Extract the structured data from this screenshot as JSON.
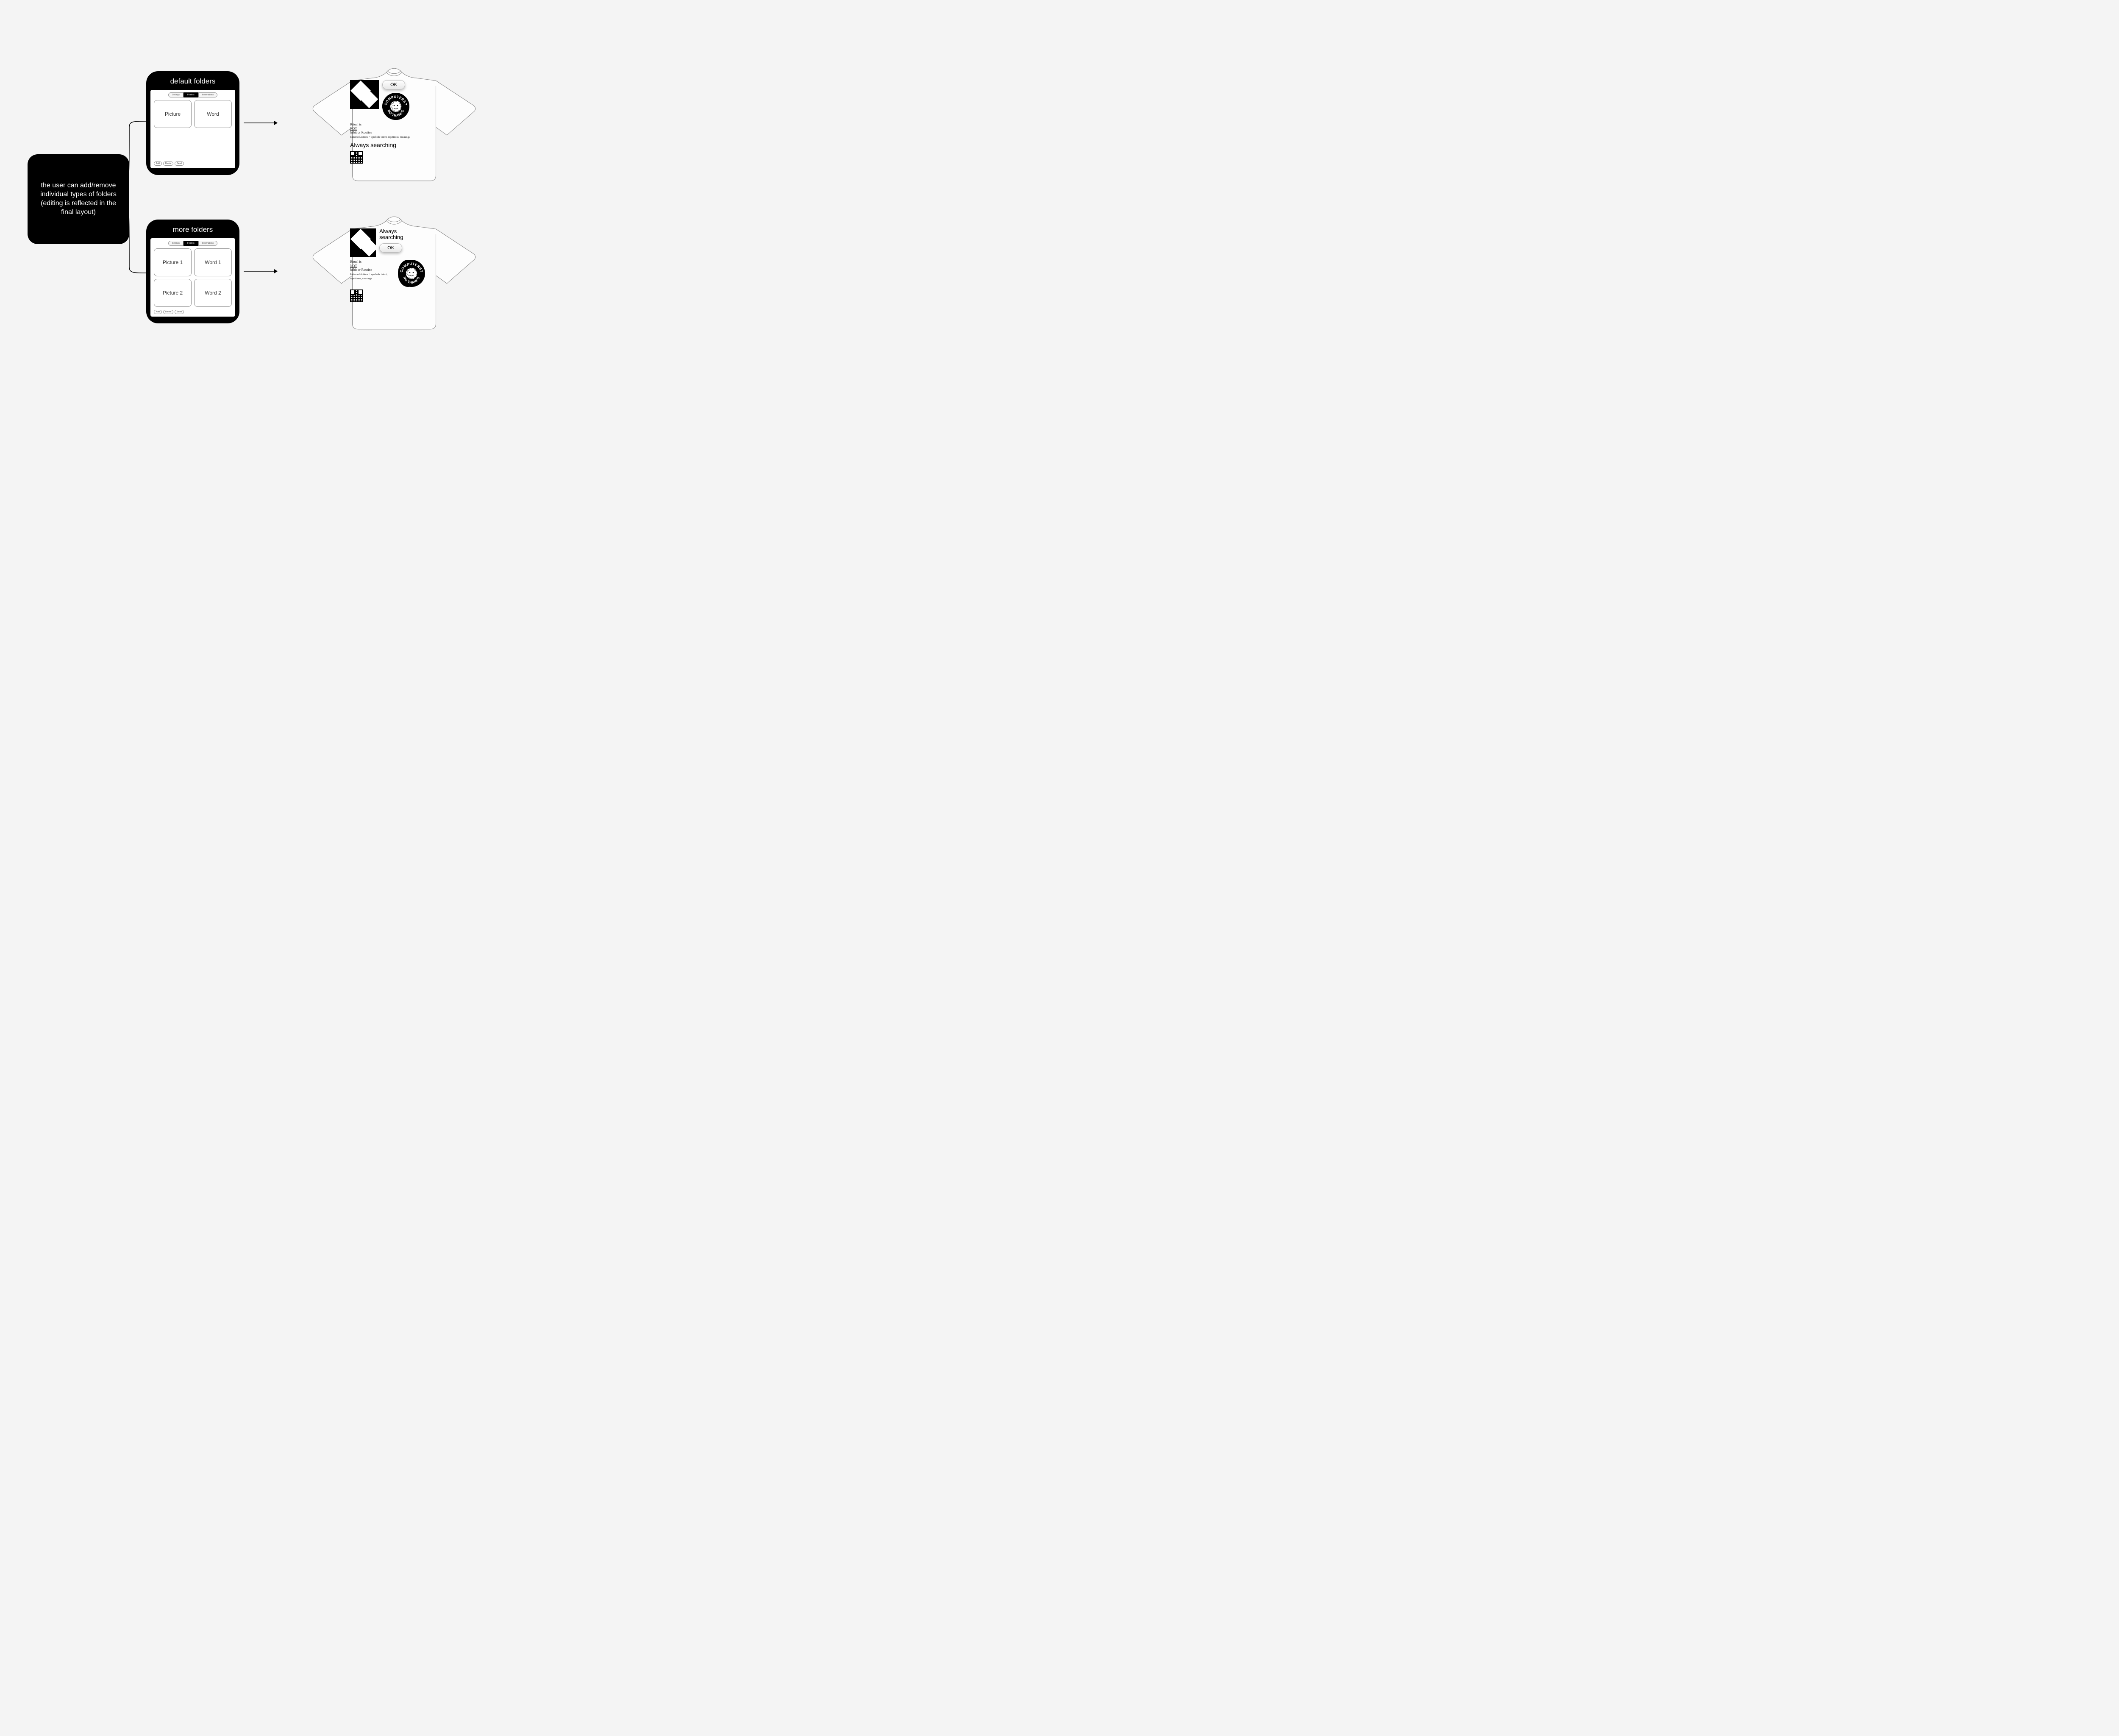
{
  "description_node": "the user can add/remove individual types of folders (editing is reflected in the final layout)",
  "device_a": {
    "title": "default folders",
    "tabs": [
      "Settings",
      "Folders",
      "Informations"
    ],
    "active_tab": 1,
    "folders": [
      "Picture",
      "Word"
    ],
    "buttons": [
      "Add",
      "Delete",
      "Send"
    ]
  },
  "device_b": {
    "title": "more folders",
    "tabs": [
      "Settings",
      "Folders",
      "Informations"
    ],
    "active_tab": 1,
    "folders": [
      "Picture 1",
      "Word 1",
      "Picture 2",
      "Word 2"
    ],
    "buttons": [
      "Add",
      "Delete",
      "Send"
    ]
  },
  "shirt_print": {
    "ok_label": "OK",
    "patch_top": "COMPUTERS?",
    "patch_bottom": "NO THANKS",
    "scribble_1": "Ritual is",
    "scribble_2": "NOT",
    "scribble_3": "habit or Routine",
    "scribble_4": "Patterned Actions",
    "scribble_5": "+ symbolic intent, repetitions, meanings",
    "tagline": "Always searching"
  }
}
